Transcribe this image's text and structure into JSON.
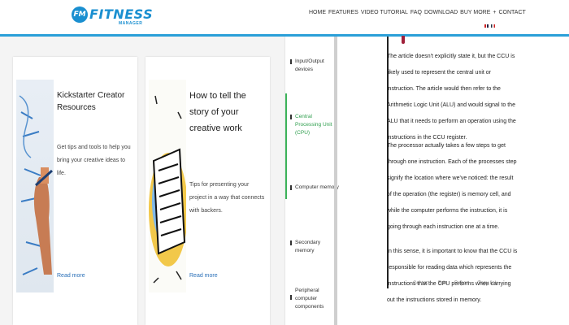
{
  "header": {
    "logo_badge": "FM",
    "logo_word": "FITNESS",
    "logo_sub": "MANAGER",
    "nav": [
      "HOME",
      "FEATURES",
      "VIDEO TUTORIAL",
      "FAQ",
      "DOWNLOAD",
      "BUY MORE",
      "+",
      "CONTACT"
    ],
    "accent_color": "#2a9fd8"
  },
  "cards": [
    {
      "title": "Kickstarter Creator Resources",
      "description": "Get tips and tools to help you bring your creative ideas to life.",
      "link": "Read more",
      "image_icon": "sketch-hand-image"
    },
    {
      "title": "How to tell the story of your creative work",
      "description": "Tips for presenting your project in a way that connects with backers.",
      "link": "Read more",
      "image_icon": "document-illustration-image"
    }
  ],
  "toc": {
    "items": [
      "Input/Output devices",
      "Central Processing Unit (CPU)",
      "Computer memory",
      "Secondary memory",
      "Peripheral computer components"
    ],
    "active_index": 1,
    "active_color": "#3cb35a"
  },
  "article": {
    "paragraphs": [
      "The article doesn't explicitly state it, but the CCU is likely used to represent the central unit or instruction. The article would then refer to the Arithmetic Logic Unit (ALU) and would signal to the ALU that it needs to perform an operation using the instructions in the CCU register.",
      "The processor actually takes a few steps to get through one instruction. Each of the processes step signify the location where we've noticed: the result of the operation (the register) is memory cell, and while the computer performs the instruction, it is going through each instruction one at a time.",
      "In this sense, it is important to know that the CCU is responsible for reading data which represents the instructions that the CPU performs when carrying out the instructions stored in memory."
    ],
    "popup_links": [
      "Contact",
      "Edit",
      "Report",
      "Copy link"
    ]
  }
}
